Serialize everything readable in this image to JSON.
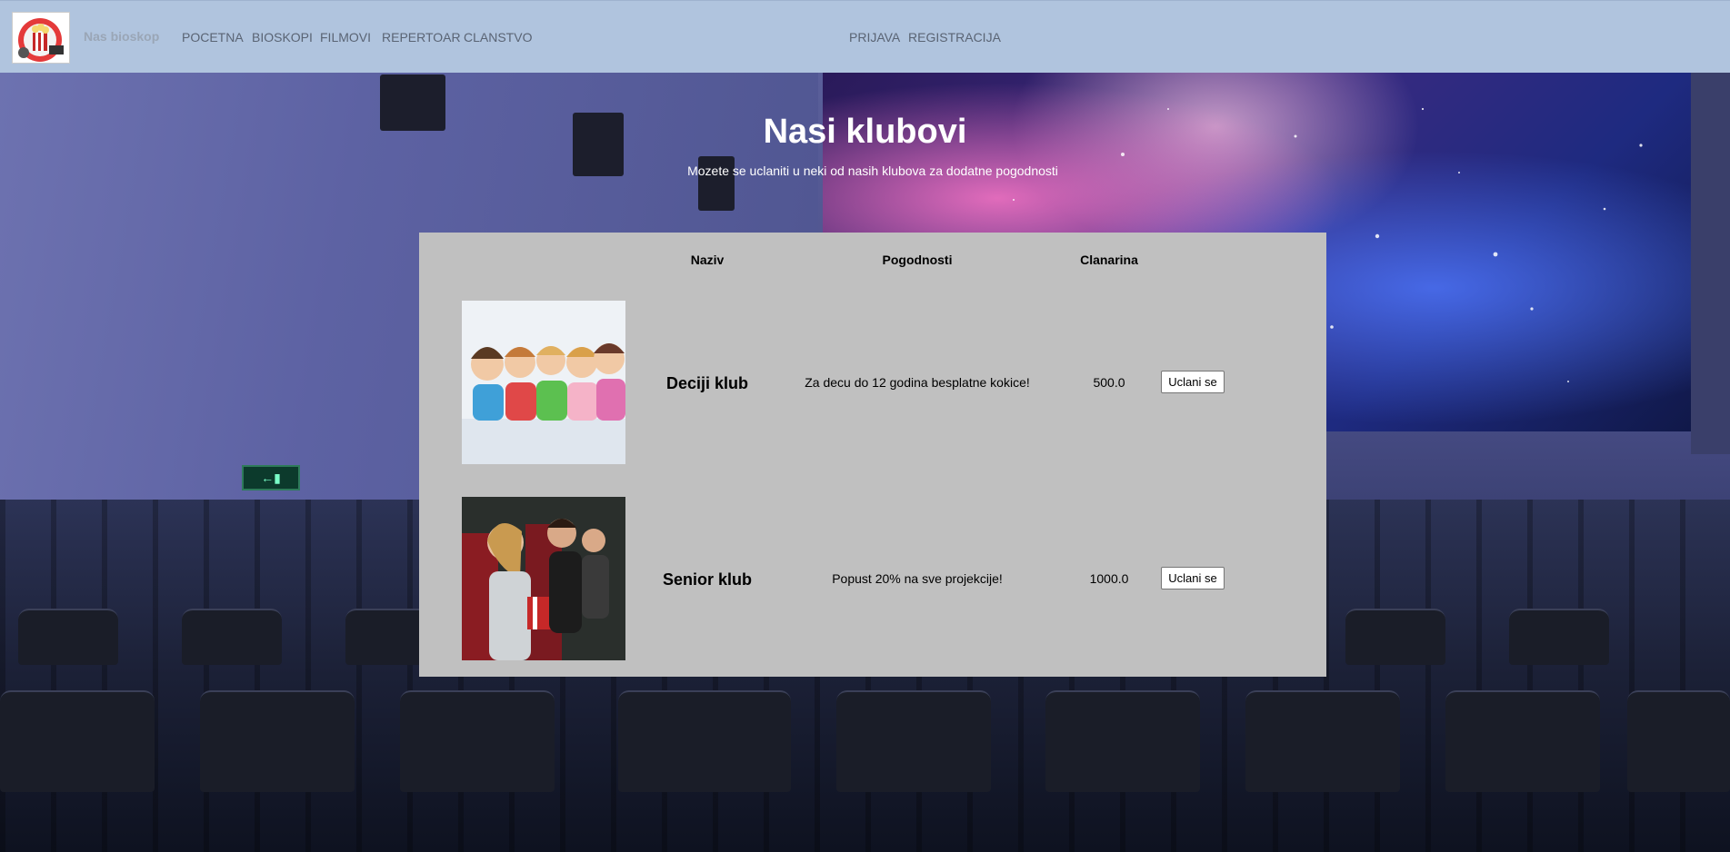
{
  "brand": {
    "name": "Nas bioskop",
    "logo_icon": "popcorn-cinema-logo-icon"
  },
  "nav": {
    "left": [
      {
        "label": "POCETNA"
      },
      {
        "label": "BIOSKOPI"
      },
      {
        "label": "FILMOVI"
      },
      {
        "label": "REPERTOAR"
      },
      {
        "label": "CLANSTVO"
      }
    ],
    "right": [
      {
        "label": "PRIJAVA"
      },
      {
        "label": "REGISTRACIJA"
      }
    ]
  },
  "hero": {
    "title": "Nasi klubovi",
    "subtitle": "Mozete se uclaniti u neki od nasih klubova za dodatne pogodnosti"
  },
  "table": {
    "headers": {
      "name": "Naziv",
      "benefits": "Pogodnosti",
      "fee": "Clanarina"
    },
    "rows": [
      {
        "name": "Deciji klub",
        "benefit": "Za decu do 12 godina besplatne kokice!",
        "fee": "500.0",
        "button": "Uclani se",
        "image_icon": "children-photo"
      },
      {
        "name": "Senior klub",
        "benefit": "Popust 20% na sve projekcije!",
        "fee": "1000.0",
        "button": "Uclani se",
        "image_icon": "audience-photo"
      }
    ]
  },
  "colors": {
    "navbar": "#b0c4de",
    "panel": "#c0c0c0",
    "hero_text": "#ffffff"
  }
}
